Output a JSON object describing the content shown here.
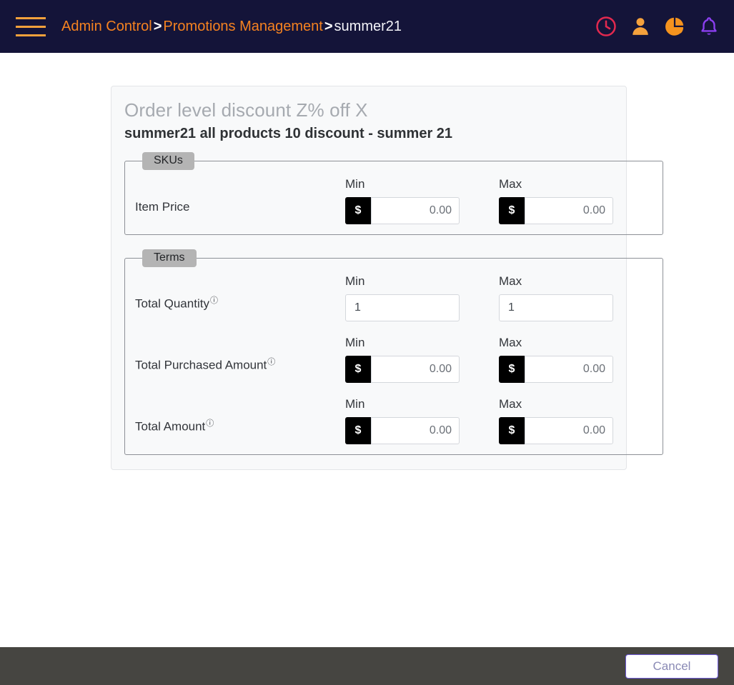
{
  "navbar": {
    "menu_icon": "hamburger-menu-icon",
    "breadcrumb": {
      "items": [
        {
          "label": "Admin Control",
          "current": false
        },
        {
          "label": "Promotions Management",
          "current": false
        },
        {
          "label": "summer21",
          "current": true
        }
      ],
      "separator": ">"
    },
    "icons": [
      {
        "name": "clock-icon",
        "color": "#e2294f"
      },
      {
        "name": "user-icon",
        "color": "#f5a13c"
      },
      {
        "name": "pie-chart-icon",
        "color": "#f5931e"
      },
      {
        "name": "bell-icon",
        "color": "#8b3ff0"
      }
    ],
    "background": "#141439",
    "link_color": "#f58220"
  },
  "card": {
    "title": "Order level discount Z% off X",
    "subtitle": "summer21 all products 10 discount - summer 21",
    "groups": [
      {
        "legend": "SKUs",
        "rows": [
          {
            "label": "Item Price",
            "help": false,
            "min": {
              "header": "Min",
              "prefix": "$",
              "value": "0.00",
              "placeholder": "0.00",
              "align": "right"
            },
            "max": {
              "header": "Max",
              "prefix": "$",
              "value": "0.00",
              "placeholder": "0.00",
              "align": "right"
            }
          }
        ]
      },
      {
        "legend": "Terms",
        "rows": [
          {
            "label": "Total Quantity",
            "help": true,
            "help_glyph": "ⓘ",
            "min": {
              "header": "Min",
              "prefix": "",
              "value": "1",
              "placeholder": "1",
              "align": "left"
            },
            "max": {
              "header": "Max",
              "prefix": "",
              "value": "1",
              "placeholder": "1",
              "align": "left"
            }
          },
          {
            "label": "Total Purchased Amount",
            "help": true,
            "help_glyph": "ⓘ",
            "min": {
              "header": "Min",
              "prefix": "$",
              "value": "0.00",
              "placeholder": "0.00",
              "align": "right"
            },
            "max": {
              "header": "Max",
              "prefix": "$",
              "value": "0.00",
              "placeholder": "0.00",
              "align": "right"
            }
          },
          {
            "label": "Total Amount",
            "help": true,
            "help_glyph": "ⓘ",
            "min": {
              "header": "Min",
              "prefix": "$",
              "value": "0.00",
              "placeholder": "0.00",
              "align": "right"
            },
            "max": {
              "header": "Max",
              "prefix": "$",
              "value": "0.00",
              "placeholder": "0.00",
              "align": "right"
            }
          }
        ]
      }
    ]
  },
  "footer": {
    "cancel_label": "Cancel",
    "background": "#464541",
    "cancel_border": "#6f5bd8"
  }
}
